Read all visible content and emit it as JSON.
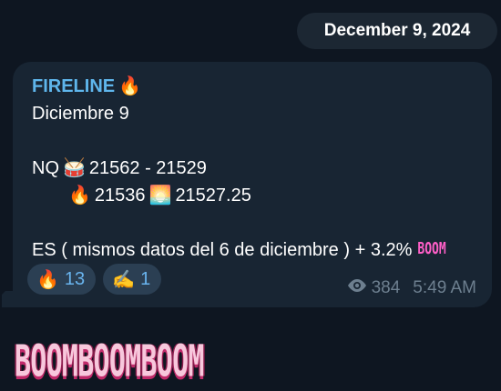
{
  "date_pill": "December 9, 2024",
  "message": {
    "sender": "FIRELINE",
    "sender_emoji": "🔥",
    "line1": "Diciembre 9",
    "nq_label": "NQ",
    "nq_emoji1": "🥁",
    "nq_range": "21562 - 21529",
    "fire_emoji": "🔥",
    "value_a": "21536",
    "sunrise_emoji": "🌅",
    "value_b": "21527.25",
    "es_text": "ES ( mismos datos del 6 de diciembre ) + 3.2%",
    "boom_tag": "BOOM"
  },
  "reactions": [
    {
      "emoji": "🔥",
      "count": "13"
    },
    {
      "emoji": "✍️",
      "count": "1"
    }
  ],
  "meta": {
    "views": "384",
    "time": "5:49 AM"
  },
  "sticker": {
    "text": "BOOMBOOMBOOM"
  }
}
